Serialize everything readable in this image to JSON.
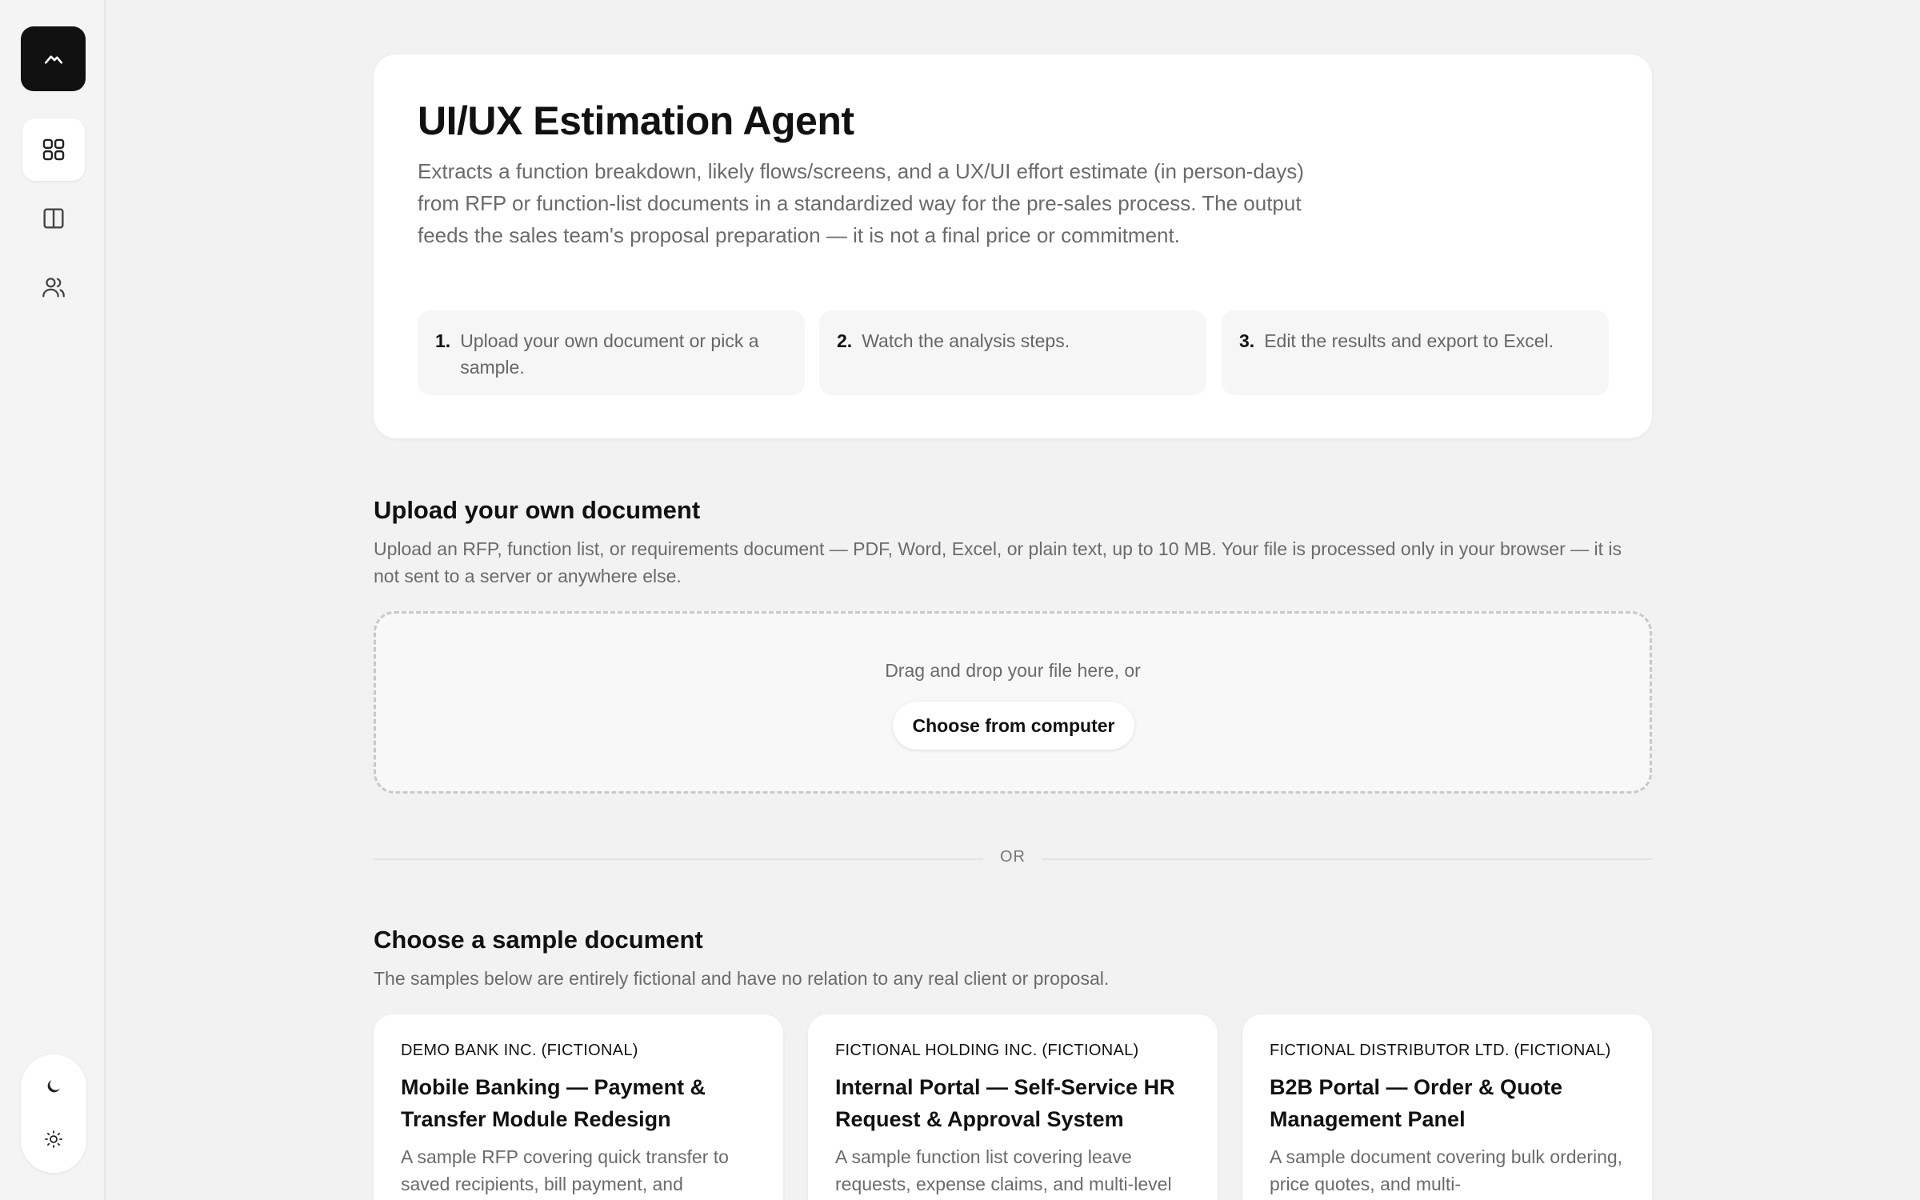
{
  "sidebar": {
    "logo_icon": "mountain-logo-icon",
    "nav": [
      {
        "icon": "grid-icon",
        "active": true
      },
      {
        "icon": "columns-icon",
        "active": false
      },
      {
        "icon": "users-icon",
        "active": false
      }
    ],
    "theme": {
      "dark_icon": "moon-icon",
      "light_icon": "sun-icon"
    }
  },
  "hero": {
    "title": "UI/UX Estimation Agent",
    "description": "Extracts a function breakdown, likely flows/screens, and a UX/UI effort estimate (in person-days) from RFP or function-list documents in a standardized way for the pre-sales process. The output feeds the sales team's proposal preparation — it is not a final price or commitment.",
    "steps": [
      {
        "num": "1.",
        "text": "Upload your own document or pick a sample."
      },
      {
        "num": "2.",
        "text": "Watch the analysis steps."
      },
      {
        "num": "3.",
        "text": "Edit the results and export to Excel."
      }
    ]
  },
  "upload": {
    "title": "Upload your own document",
    "description": "Upload an RFP, function list, or requirements document — PDF, Word, Excel, or plain text, up to 10 MB. Your file is processed only in your browser — it is not sent to a server or anywhere else.",
    "drag_text": "Drag and drop your file here, or",
    "button_label": "Choose from computer"
  },
  "divider": {
    "label": "OR"
  },
  "samples": {
    "title": "Choose a sample document",
    "description": "The samples below are entirely fictional and have no relation to any real client or proposal.",
    "cards": [
      {
        "company": "DEMO BANK INC. (FICTIONAL)",
        "title": "Mobile Banking — Payment & Transfer Module Redesign",
        "description": "A sample RFP covering quick transfer to saved recipients, bill payment, and"
      },
      {
        "company": "FICTIONAL HOLDING INC. (FICTIONAL)",
        "title": "Internal Portal — Self-Service HR Request & Approval System",
        "description": "A sample function list covering leave requests, expense claims, and multi-level"
      },
      {
        "company": "FICTIONAL DISTRIBUTOR LTD. (FICTIONAL)",
        "title": "B2B Portal — Order & Quote Management Panel",
        "description": "A sample document covering bulk ordering, price quotes, and multi-"
      }
    ]
  },
  "colors": {
    "accent": "#111111",
    "muted": "#6b6b6b",
    "background": "#f2f2f2"
  }
}
